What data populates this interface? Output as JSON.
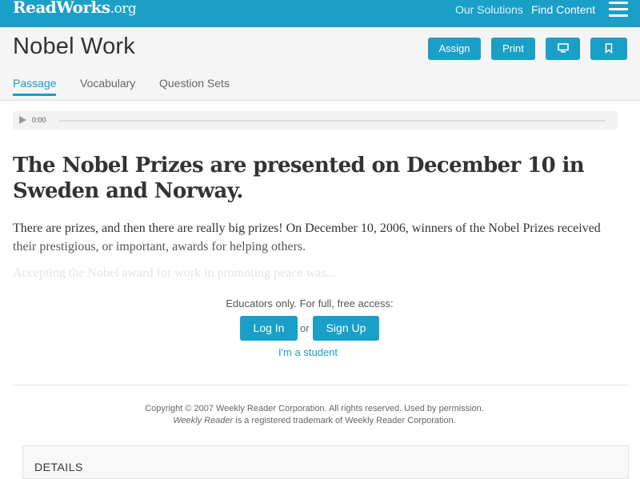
{
  "header": {
    "logo_main": "ReadWorks",
    "logo_suffix": ".org",
    "nav": {
      "solutions": "Our Solutions",
      "find": "Find Content"
    }
  },
  "title_bar": {
    "title": "Nobel Work",
    "buttons": {
      "assign": "Assign",
      "print": "Print"
    },
    "tabs": [
      "Passage",
      "Vocabulary",
      "Question Sets"
    ]
  },
  "audio": {
    "time": "0:00"
  },
  "article": {
    "headline": "The Nobel Prizes are presented on December 10 in Sweden and Norway.",
    "para_line1": "There are prizes, and then there are really big prizes! On December 10, 2006, winners of the Nobel Prizes received",
    "para_line2": "their prestigious, or important, awards for helping others.",
    "faded": "Accepting the Nobel award for work in promoting peace was..."
  },
  "gate": {
    "message": "Educators only. For full, free access:",
    "login": "Log In",
    "or": "or",
    "signup": "Sign Up",
    "student": "I'm a student"
  },
  "footer": {
    "copyright": "Copyright © 2007 Weekly Reader Corporation. All rights reserved. Used by permission.",
    "trademark_italic": "Weekly Reader",
    "trademark_rest": " is a registered trademark of Weekly Reader Corporation."
  },
  "details": {
    "title": "DETAILS"
  },
  "colors": {
    "accent": "#1a9fc8"
  },
  "icons": [
    "hamburger-icon",
    "monitor-icon",
    "bookmark-icon",
    "play-icon"
  ]
}
